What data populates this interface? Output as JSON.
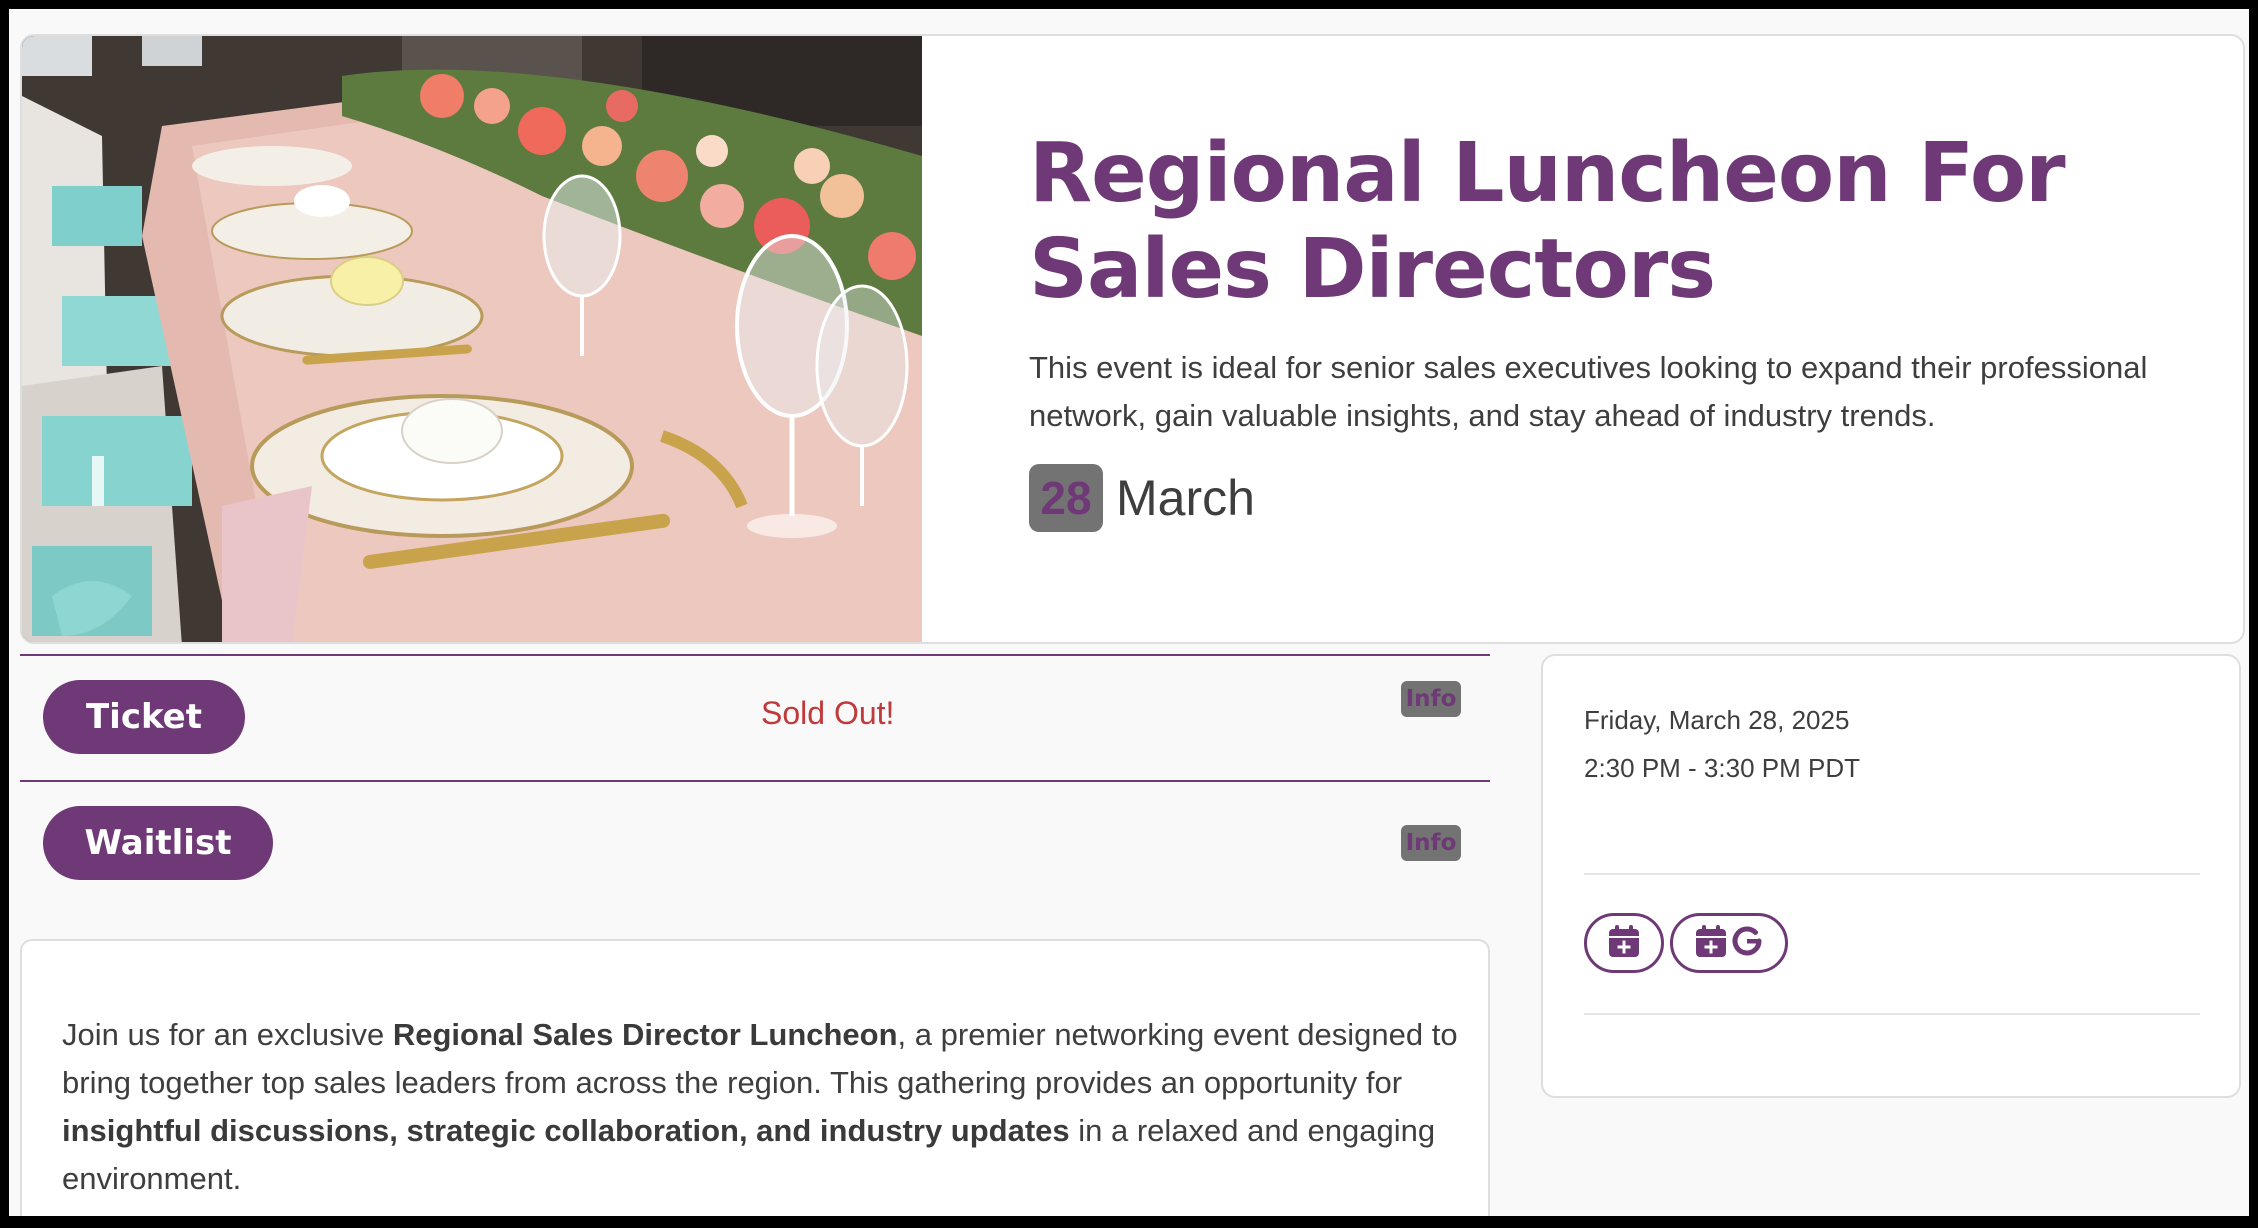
{
  "event": {
    "title": "Regional Luncheon For Sales Directors",
    "summary": "This event is ideal for senior sales executives looking to expand their professional network, gain valuable insights, and stay ahead of industry trends.",
    "day": "28",
    "month": "March"
  },
  "tickets": {
    "ticket_label": "Ticket",
    "sold_out_label": "Sold Out!",
    "info_label": "Info",
    "waitlist_label": "Waitlist"
  },
  "description": {
    "p1": "Join us for an exclusive ",
    "b1": "Regional Sales Director Luncheon",
    "p2": ", a premier networking event designed to bring together top sales leaders from across the region. This gathering provides an opportunity for ",
    "b2": "insightful discussions, strategic collaboration, and industry updates",
    "p3": " in a relaxed and engaging environment."
  },
  "schedule": {
    "date": "Friday, March 28, 2025",
    "time": "2:30 PM - 3:30 PM PDT"
  },
  "calendar": {
    "add_icon": "calendar-plus-icon",
    "google_icon": "calendar-plus-google-icon"
  },
  "colors": {
    "brand": "#6e3976",
    "sold_out": "#c0393b",
    "badge_bg": "#737373"
  }
}
